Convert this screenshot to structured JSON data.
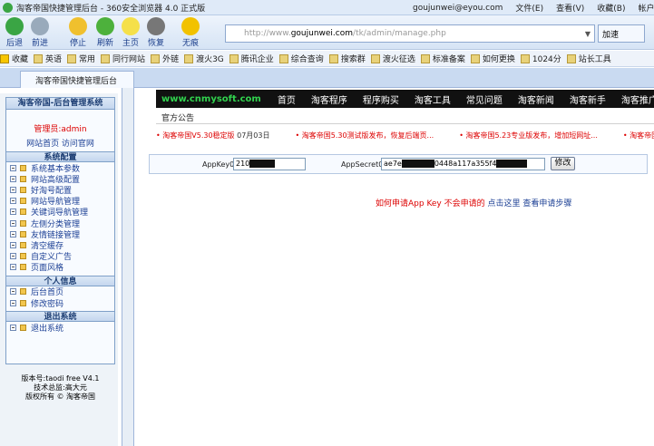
{
  "window": {
    "title": "淘客帝国快捷管理后台 - 360安全浏览器 4.0 正式版",
    "user": "goujunwei@eyou.com",
    "menu": [
      "文件(E)",
      "查看(V)",
      "收藏(B)",
      "帐户"
    ]
  },
  "toolbar": {
    "buttons": [
      "后退",
      "前进",
      "停止",
      "刷新",
      "主页",
      "恢复",
      "无痕"
    ],
    "address": {
      "prefix": "http://www.",
      "domain": "goujunwei.com",
      "suffix": "/tk/admin/manage.php"
    },
    "accel": "加速"
  },
  "bookmarks": [
    "收藏",
    "英语",
    "常用",
    "同行网站",
    "外链",
    "渡火3G",
    "腾讯企业",
    "综合查询",
    "搜索群",
    "渡火征选",
    "标准备案",
    "如何更换",
    "1024分",
    "站长工具"
  ],
  "tab": "淘客帝国快捷管理后台",
  "sidebar": {
    "title": "淘客帝国-后台管理系统",
    "admin_label": "管理员:",
    "admin_name": "admin",
    "links": "网站首页 访问官网",
    "sections": [
      {
        "title": "系统配置",
        "items": [
          "系统基本参数",
          "网站高级配置",
          "好淘号配置",
          "网站导航管理",
          "关键词导航管理",
          "左侧分类管理",
          "友情链接管理",
          "清空缓存",
          "自定义广告",
          "页面风格"
        ]
      },
      {
        "title": "个人信息",
        "items": [
          "后台首页",
          "修改密码"
        ]
      },
      {
        "title": "退出系统",
        "items": [
          "退出系统"
        ]
      }
    ],
    "footer": [
      "版本号:taodi free V4.1",
      "技术总监:高大元",
      "版权所有 © 淘客帝国"
    ]
  },
  "main": {
    "logo": "www.cnmysoft.com",
    "nav": [
      "首页",
      "淘客程序",
      "程序购买",
      "淘客工具",
      "常见问题",
      "淘客新闻",
      "淘客新手",
      "淘客推广"
    ],
    "notice_title": "官方公告",
    "news": [
      {
        "text": "淘客帝国V5.30稳定版",
        "date": "07月03日"
      },
      {
        "text": "淘客帝国5.30测试版发布，恢复后端页...",
        "date": ""
      },
      {
        "text": "淘客帝国5.23专业版发布，增加短网址...",
        "date": ""
      },
      {
        "text": "淘客帝国",
        "date": ""
      }
    ],
    "form": {
      "key_label": "AppKey0",
      "key_value": "210",
      "secret_label": "AppSecret0",
      "secret_prefix": "ae7e",
      "secret_mid": "0448a117a355f4",
      "button": "修改"
    },
    "apply": {
      "text": "如何申请App Key 不会申请的",
      "link1": "点击这里",
      "link2": "查看申请步骤"
    }
  }
}
